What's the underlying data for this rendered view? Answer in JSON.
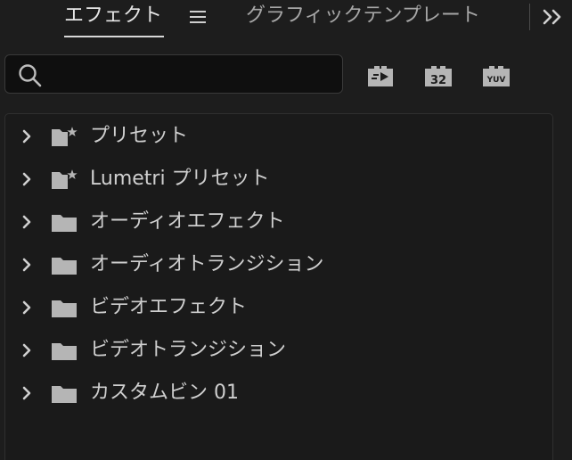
{
  "tabs": {
    "effects_label": "エフェクト",
    "graphics_label": "グラフィックテンプレート"
  },
  "search": {
    "value": "",
    "placeholder": ""
  },
  "filters": {
    "accelerated": "accelerated-effects-icon",
    "bit32_label": "32",
    "yuv_label": "YUV"
  },
  "tree": {
    "items": [
      {
        "label": "プリセット",
        "icon": "preset-folder-icon"
      },
      {
        "label": "Lumetri プリセット",
        "icon": "preset-folder-icon"
      },
      {
        "label": "オーディオエフェクト",
        "icon": "folder-icon"
      },
      {
        "label": "オーディオトランジション",
        "icon": "folder-icon"
      },
      {
        "label": "ビデオエフェクト",
        "icon": "folder-icon"
      },
      {
        "label": "ビデオトランジション",
        "icon": "folder-icon"
      },
      {
        "label": "カスタムビン 01",
        "icon": "folder-icon"
      }
    ]
  },
  "colors": {
    "background": "#1d1d1d",
    "text": "#cfcfcf",
    "icon": "#b5b5b5",
    "search_bg": "#0f0f0f"
  }
}
